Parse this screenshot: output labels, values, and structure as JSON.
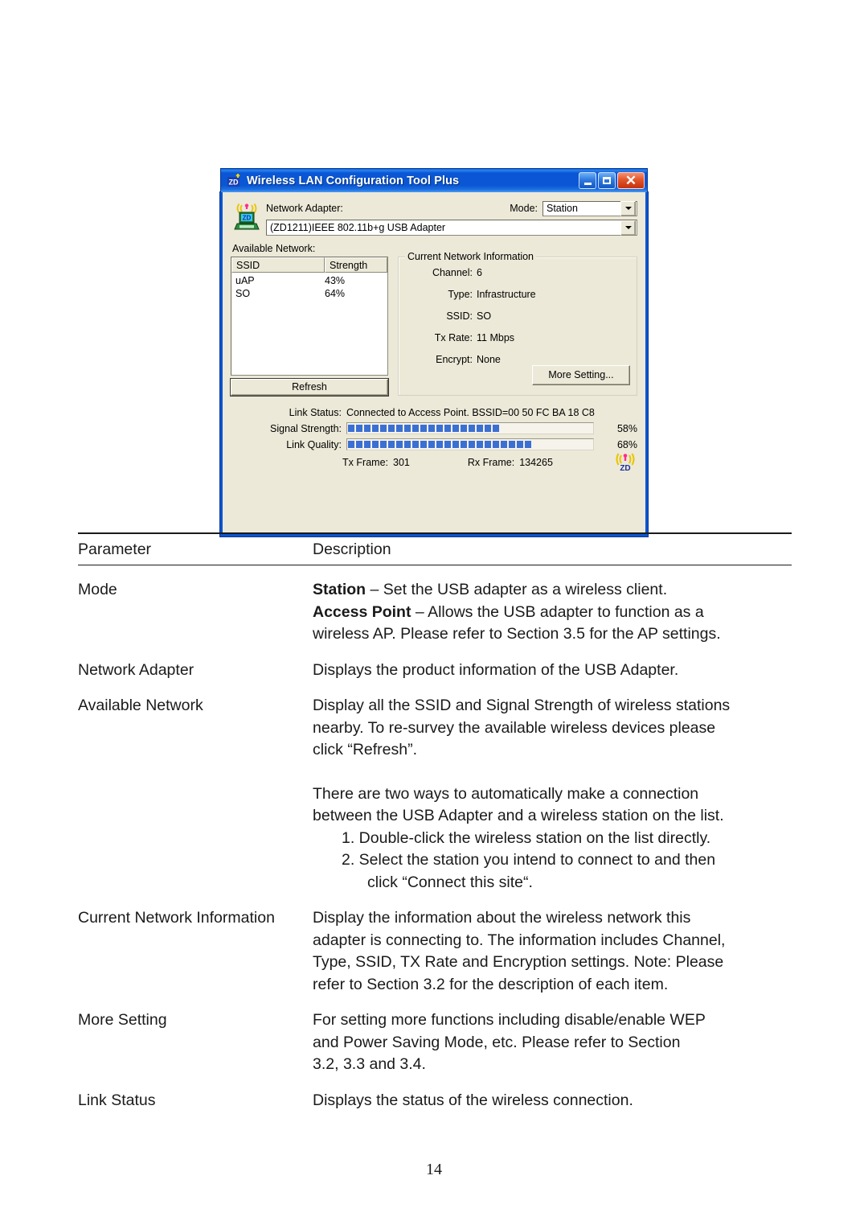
{
  "dialog": {
    "title": "Wireless LAN Configuration Tool Plus",
    "title_icon": "zd-app-icon",
    "window_buttons": {
      "minimize": "minimize-icon",
      "maximize": "maximize-icon",
      "close": "close-icon"
    },
    "adapter": {
      "label": "Network Adapter:",
      "value": "(ZD1211)IEEE 802.11b+g USB Adapter",
      "icon": "wireless-laptop-icon"
    },
    "mode": {
      "label": "Mode:",
      "value": "Station",
      "options": [
        "Station",
        "Access Point"
      ]
    },
    "available_network": {
      "label": "Available Network:",
      "columns": [
        "SSID",
        "Strength"
      ],
      "rows": [
        {
          "ssid": "uAP",
          "strength": "43%"
        },
        {
          "ssid": "SO",
          "strength": "64%"
        }
      ],
      "refresh_label": "Refresh"
    },
    "current_network": {
      "title": "Current Network Information",
      "fields": [
        {
          "key": "Channel:",
          "value": "6"
        },
        {
          "key": "Type:",
          "value": "Infrastructure"
        },
        {
          "key": "SSID:",
          "value": "SO"
        },
        {
          "key": "Tx Rate:",
          "value": "11 Mbps"
        },
        {
          "key": "Encrypt:",
          "value": "None"
        }
      ],
      "more_setting_label": "More Setting..."
    },
    "status": {
      "link_status_key": "Link Status:",
      "link_status_value": "Connected to Access Point. BSSID=00 50 FC BA 18 C8",
      "signal_strength_key": "Signal Strength:",
      "signal_strength_pct": "58%",
      "signal_strength_segments": 19,
      "link_quality_key": "Link Quality:",
      "link_quality_pct": "68%",
      "link_quality_segments": 23,
      "tx_frame_key": "Tx Frame:",
      "tx_frame_value": "301",
      "rx_frame_key": "Rx Frame:",
      "rx_frame_value": "134265",
      "tray_icon": "zd-wireless-tray-icon",
      "bar_color": "#3b6fd4"
    }
  },
  "table": {
    "header": {
      "parameter": "Parameter",
      "description": "Description"
    },
    "rows": [
      {
        "parameter": "Mode",
        "lines": [
          {
            "bold": "Station",
            "text": " – Set the USB adapter as a wireless client."
          },
          {
            "bold": "Access Point",
            "text": " – Allows the USB adapter to function as a"
          },
          {
            "text": "wireless AP. Please refer to Section 3.5 for the AP settings."
          }
        ]
      },
      {
        "parameter": "Network Adapter",
        "lines": [
          {
            "text": "Displays the product information of the USB Adapter."
          }
        ]
      },
      {
        "parameter": "Available Network",
        "lines": [
          {
            "text": "Display all the SSID and Signal Strength of wireless stations"
          },
          {
            "text": "nearby. To re-survey the available wireless devices please"
          },
          {
            "text": "click “Refresh”."
          },
          {
            "text": "There are two ways to automatically make a connection",
            "gap": true
          },
          {
            "text": "between the USB Adapter and a wireless station on the list."
          },
          {
            "text": "1. Double-click the wireless station on the list directly.",
            "indent": 1
          },
          {
            "text": "2. Select the station you intend to connect to and then",
            "indent": 1
          },
          {
            "text": "click “Connect this site“.",
            "indent": 2
          }
        ]
      },
      {
        "parameter": "Current Network Information",
        "lines": [
          {
            "text": "Display the information about the wireless network this"
          },
          {
            "text": "adapter is connecting to. The information includes Channel,"
          },
          {
            "text": "Type, SSID, TX Rate and Encryption settings. Note: Please"
          },
          {
            "text": "refer to Section 3.2 for the description of each item."
          }
        ]
      },
      {
        "parameter": "More Setting",
        "lines": [
          {
            "text": "For setting more functions including disable/enable WEP"
          },
          {
            "text": "and Power Saving Mode, etc. Please refer to Section"
          },
          {
            "text": "3.2, 3.3 and 3.4."
          }
        ]
      },
      {
        "parameter": "Link Status",
        "lines": [
          {
            "text": "Displays the status of the wireless connection."
          }
        ]
      }
    ]
  },
  "page_number": "14"
}
